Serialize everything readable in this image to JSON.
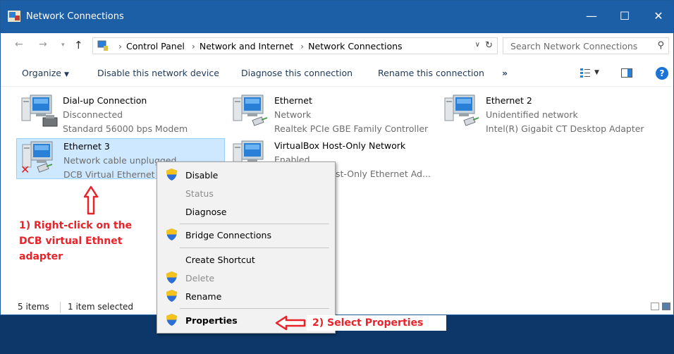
{
  "window": {
    "title": "Network Connections",
    "minimize": "—",
    "maximize": "☐",
    "close": "✕"
  },
  "address": {
    "breadcrumbs": [
      "Control Panel",
      "Network and Internet",
      "Network Connections"
    ],
    "search_placeholder": "Search Network Connections"
  },
  "commands": {
    "organize": "Organize",
    "disable": "Disable this network device",
    "diagnose": "Diagnose this connection",
    "rename": "Rename this connection",
    "more": "»",
    "help": "?"
  },
  "items": [
    {
      "name": "Dial-up Connection",
      "line2": "Disconnected",
      "line3": "Standard 56000 bps Modem"
    },
    {
      "name": "Ethernet",
      "line2": "Network",
      "line3": "Realtek PCIe GBE Family Controller"
    },
    {
      "name": "Ethernet 2",
      "line2": "Unidentified network",
      "line3": "Intel(R) Gigabit CT Desktop Adapter"
    },
    {
      "name": "Ethernet 3",
      "line2": "Network cable unplugged",
      "line3": "DCB Virtual Ethernet"
    },
    {
      "name": "VirtualBox Host-Only Network",
      "line2": "Enabled",
      "line3": "st-Only Ethernet Ad..."
    }
  ],
  "status": {
    "count": "5 items",
    "selected": "1 item selected"
  },
  "context_menu": {
    "disable": "Disable",
    "status": "Status",
    "diagnose": "Diagnose",
    "bridge": "Bridge Connections",
    "shortcut": "Create Shortcut",
    "delete": "Delete",
    "rename": "Rename",
    "properties": "Properties"
  },
  "annotations": {
    "step1_line1": "1) Right-click on the",
    "step1_line2": "DCB virtual Ethnet",
    "step1_line3": "adapter",
    "step2": "2) Select Properties"
  },
  "colors": {
    "titlebar": "#1c5fa6",
    "selection": "#cde8ff",
    "annotation": "#e8232a",
    "desktop": "#0c3768"
  }
}
